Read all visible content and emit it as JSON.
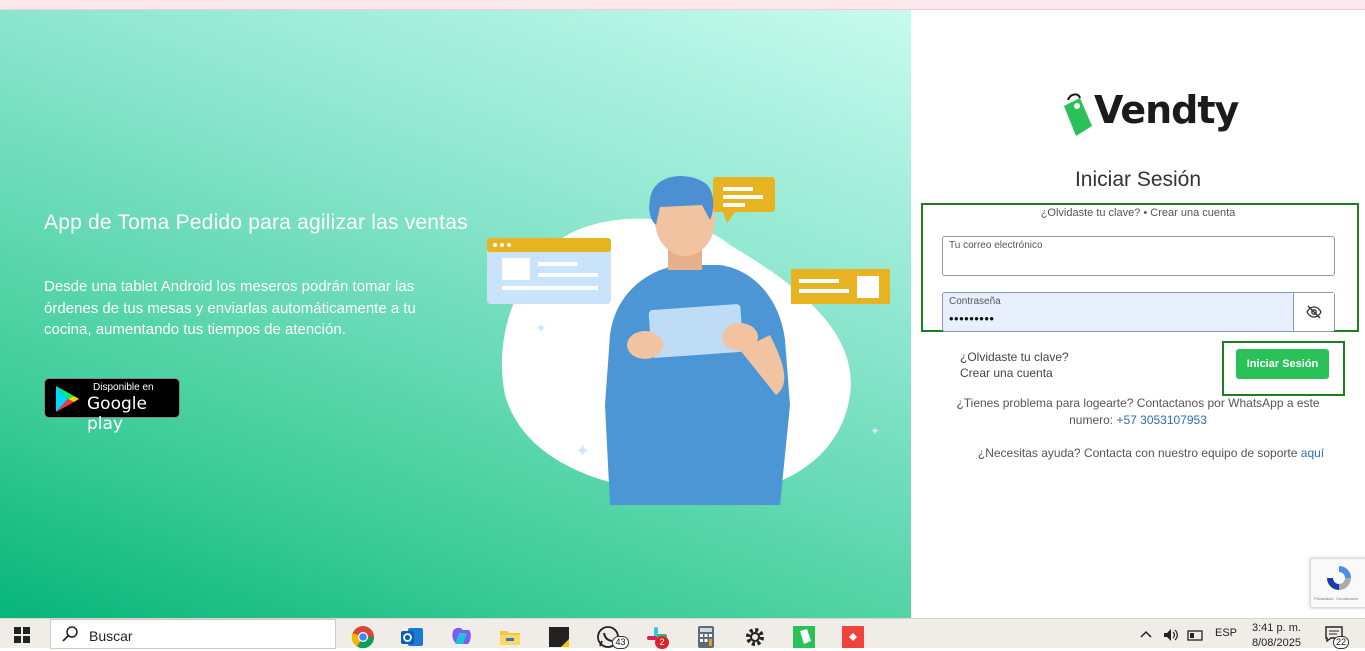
{
  "hero": {
    "title": "App de Toma Pedido para agilizar las ventas",
    "description": "Desde una tablet Android los meseros podrán tomar las órdenes de tus mesas y enviarlas automáticamente a tu cocina, aumentando tus tiempos de atención.",
    "store_badge": {
      "small": "Disponible en",
      "big": "Google play",
      "icon": "google-play-icon"
    }
  },
  "login": {
    "brand": "Vendty",
    "title": "Iniciar Sesión",
    "top_links": "¿Olvidaste tu clave? • Crear una cuenta",
    "email": {
      "label": "Tu correo electrónico",
      "value": ""
    },
    "password": {
      "label": "Contraseña",
      "value": "•••••••••",
      "toggle_icon": "eye-slash-icon"
    },
    "forgot_link": "¿Olvidaste tu clave?",
    "create_link": "Crear una cuenta",
    "submit_label": "Iniciar Sesión",
    "problem_text": "¿Tienes problema para logearte? Contactanos por WhatsApp a este numero:",
    "phone": "+57 3053107953",
    "help_text": "¿Necesitas ayuda? Contacta con nuestro equipo de soporte",
    "help_link": "aquí",
    "recaptcha_text": "Privacidad - Condiciones"
  },
  "taskbar": {
    "search_placeholder": "Buscar",
    "whatsapp_badge": "43",
    "slack_badge": "2",
    "language": "ESP",
    "time": "3:41 p. m.",
    "date": "8/08/2025",
    "notification_count": "22"
  },
  "colors": {
    "accent": "#2bc159",
    "highlight": "#1e7d1e",
    "link": "#2c6db5"
  }
}
